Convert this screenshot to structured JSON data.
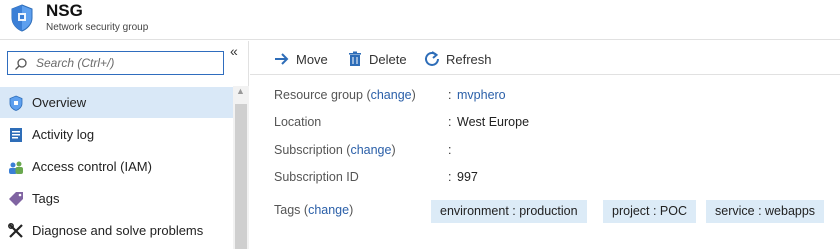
{
  "header": {
    "title": "NSG",
    "subtitle": "Network security group"
  },
  "sidebar": {
    "search_placeholder": "Search (Ctrl+/)",
    "collapse_glyph": "«",
    "items": [
      {
        "label": "Overview",
        "icon": "shield-icon"
      },
      {
        "label": "Activity log",
        "icon": "activity-log-icon"
      },
      {
        "label": "Access control (IAM)",
        "icon": "users-icon"
      },
      {
        "label": "Tags",
        "icon": "tag-icon"
      },
      {
        "label": "Diagnose and solve problems",
        "icon": "wrench-icon"
      }
    ]
  },
  "toolbar": {
    "move_label": "Move",
    "delete_label": "Delete",
    "refresh_label": "Refresh"
  },
  "properties": {
    "resource_group": {
      "label": "Resource group",
      "change": "change",
      "value": "mvphero"
    },
    "location": {
      "label": "Location",
      "value": "West Europe"
    },
    "subscription": {
      "label": "Subscription",
      "change": "change",
      "value": ""
    },
    "subscription_id": {
      "label": "Subscription ID",
      "value": "997"
    },
    "tags": {
      "label": "Tags",
      "change": "change"
    }
  },
  "tags": [
    "environment : production",
    "project : POC",
    "service : webapps"
  ],
  "colors": {
    "accent": "#2a5fa8",
    "active_nav": "#d9e8f7",
    "tag_bg": "#dcebf7"
  }
}
